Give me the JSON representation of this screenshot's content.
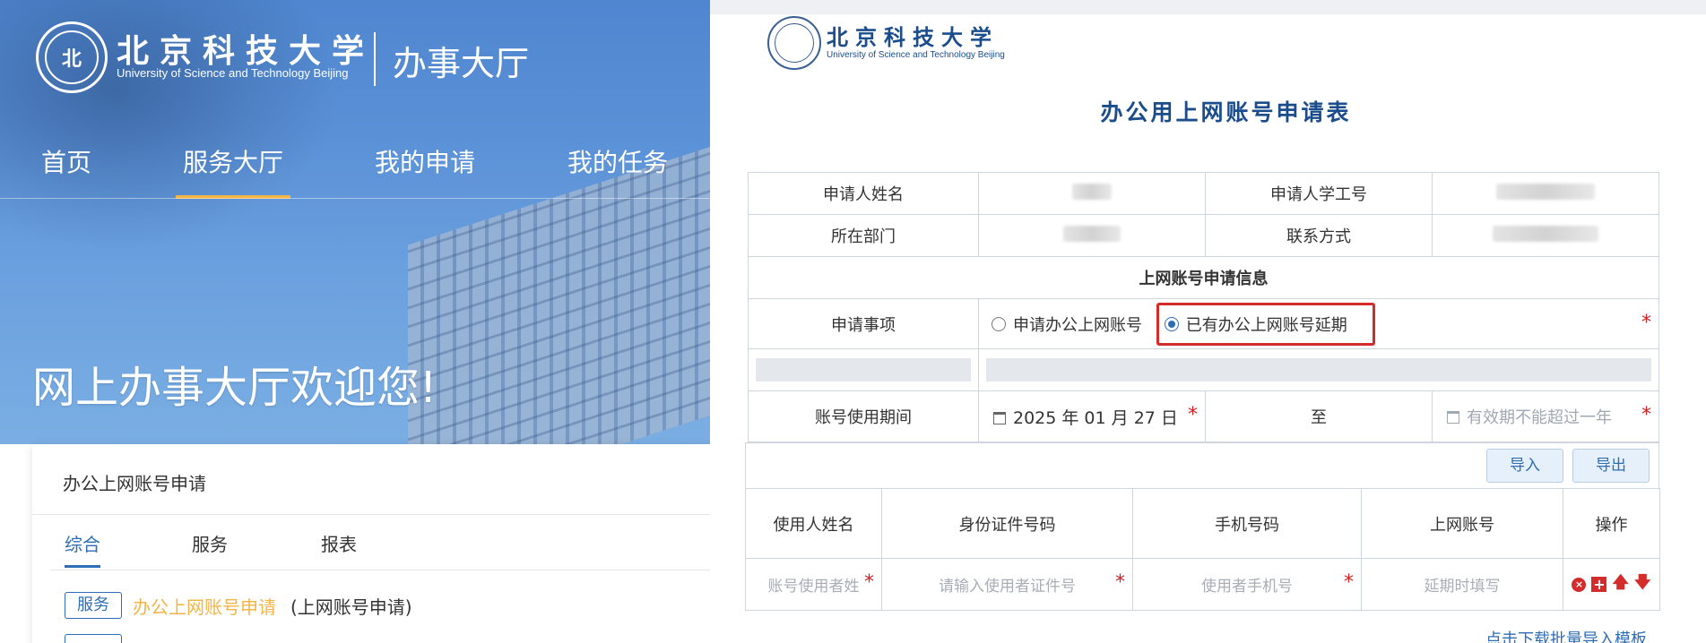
{
  "left": {
    "logo": {
      "seal_glyph": "北",
      "name_cn": "北京科技大学",
      "name_en": "University of Science and Technology Beijing",
      "hall": "办事大厅"
    },
    "nav": [
      "首页",
      "服务大厅",
      "我的申请",
      "我的任务"
    ],
    "nav_active": "服务大厅",
    "welcome": "网上办事大厅欢迎您!",
    "card": {
      "title": "办公上网账号申请",
      "tabs": [
        "综合",
        "服务",
        "报表"
      ],
      "active_tab": "综合",
      "item": {
        "badge": "服务",
        "link": "办公上网账号申请",
        "suffix": "(上网账号申请)"
      }
    }
  },
  "right": {
    "logo": {
      "name_cn": "北京科技大学",
      "name_en": "University of Science and Technology Beijing"
    },
    "form_title": "办公用上网账号申请表",
    "fields": {
      "applicant_name": "申请人姓名",
      "applicant_id": "申请人学工号",
      "department": "所在部门",
      "contact": "联系方式"
    },
    "section_title": "上网账号申请信息",
    "apply_item": {
      "label": "申请事项",
      "options": [
        "申请办公上网账号",
        "已有办公上网账号延期"
      ],
      "selected": "已有办公上网账号延期"
    },
    "period": {
      "label": "账号使用期间",
      "start_date": "2025 年 01 月 27 日",
      "separator": "至",
      "end_placeholder": "有效期不能超过一年"
    },
    "toolbar": {
      "import": "导入",
      "export": "导出"
    },
    "grid": {
      "headers": [
        "使用人姓名",
        "身份证件号码",
        "手机号码",
        "上网账号",
        "操作"
      ],
      "placeholders": [
        "账号使用者姓",
        "请输入使用者证件号",
        "使用者手机号",
        "延期时填写"
      ]
    },
    "required_mark": "*",
    "footer_link": "点击下载批量导入模板"
  },
  "colors": {
    "primary": "#2f6db5",
    "highlight": "#f2b546",
    "required": "#c22222",
    "hero": "#5a90d6"
  }
}
